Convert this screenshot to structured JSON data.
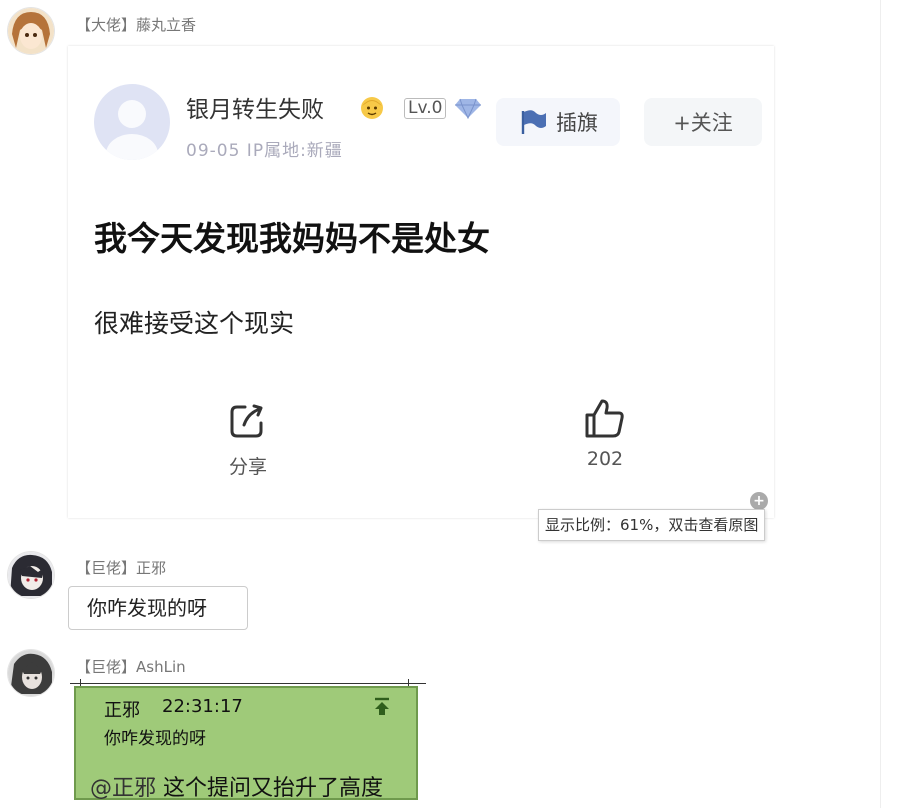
{
  "messages": [
    {
      "sender": "【大佬】藤丸立香"
    },
    {
      "sender": "【巨佬】正邪",
      "text": "你咋发现的呀"
    },
    {
      "sender": "【巨佬】AshLin"
    }
  ],
  "post": {
    "username": "银月转生失败",
    "level": "Lv.0",
    "meta": "09-05  IP属地:新疆",
    "flag_label": "插旗",
    "follow_label": "+关注",
    "title": "我今天发现我妈妈不是处女",
    "body": "很难接受这个现实",
    "share_label": "分享",
    "like_count": "202"
  },
  "tooltip": "显示比例：61%，双击查看原图",
  "quote": {
    "name": "正邪",
    "time": "22:31:17",
    "text": "你咋发现的呀",
    "mention": "@正邪",
    "reply": " 这个提问又抬升了高度"
  },
  "colors": {
    "quote_bg": "#9fca79",
    "quote_border": "#6f9a4d",
    "post_avatar_bg": "#dfe3f4"
  }
}
